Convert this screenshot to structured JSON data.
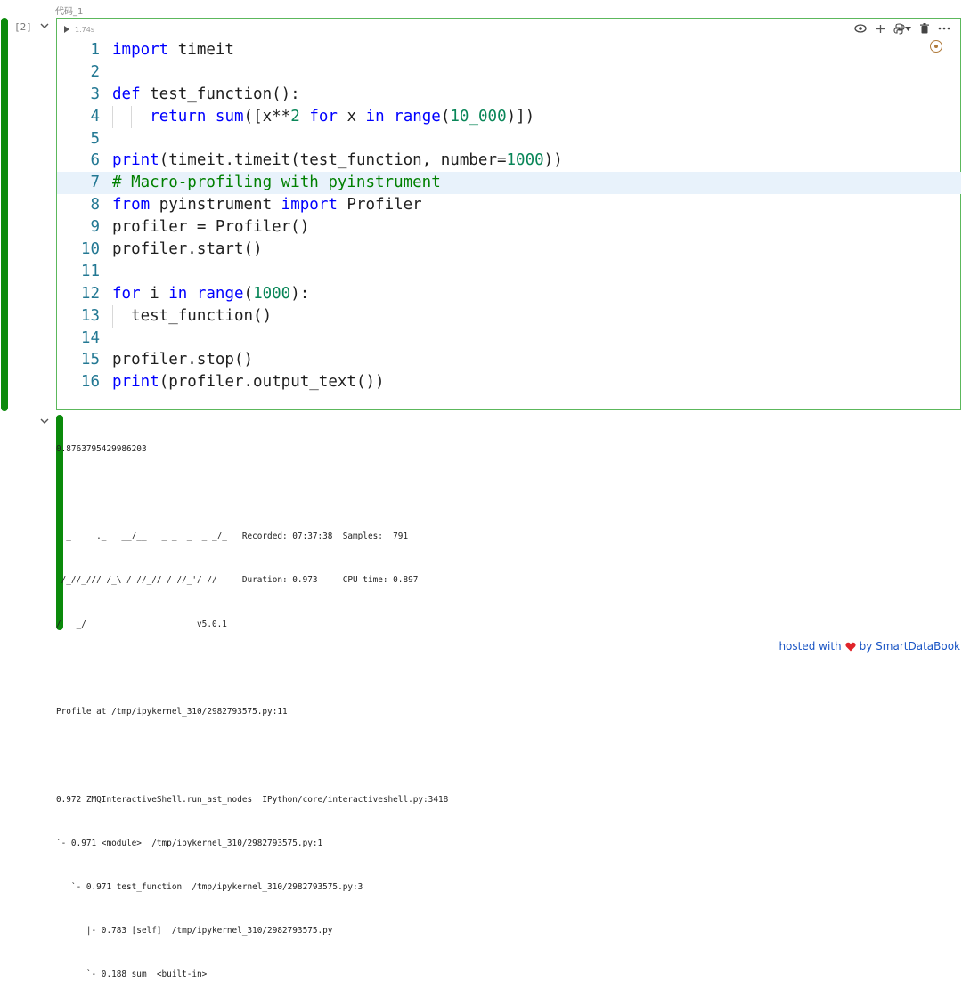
{
  "cell": {
    "label": "代码_1",
    "exec_count": "[2]",
    "exec_time": "1.74s"
  },
  "code_lines": [
    {
      "num": "1",
      "text": "import timeit"
    },
    {
      "num": "2",
      "text": ""
    },
    {
      "num": "3",
      "text": "def test_function():"
    },
    {
      "num": "4",
      "text": "    return sum([x**2 for x in range(10_000)])"
    },
    {
      "num": "5",
      "text": ""
    },
    {
      "num": "6",
      "text": "print(timeit.timeit(test_function, number=1000))"
    },
    {
      "num": "7",
      "text": "# Macro-profiling with pyinstrument"
    },
    {
      "num": "8",
      "text": "from pyinstrument import Profiler"
    },
    {
      "num": "9",
      "text": "profiler = Profiler()"
    },
    {
      "num": "10",
      "text": "profiler.start()"
    },
    {
      "num": "11",
      "text": ""
    },
    {
      "num": "12",
      "text": "for i in range(1000):"
    },
    {
      "num": "13",
      "text": "  test_function()"
    },
    {
      "num": "14",
      "text": ""
    },
    {
      "num": "15",
      "text": "profiler.stop()"
    },
    {
      "num": "16",
      "text": "print(profiler.output_text())"
    }
  ],
  "output_lines": [
    "0.8763795429986203",
    "",
    "  _     ._   __/__   _ _  _  _ _/_   Recorded: 07:37:38  Samples:  791",
    " /_//_/// /_\\ / //_// / //_'/ //     Duration: 0.973     CPU time: 0.897",
    "/   _/                      v5.0.1",
    "",
    "Profile at /tmp/ipykernel_310/2982793575.py:11",
    "",
    "0.972 ZMQInteractiveShell.run_ast_nodes  IPython/core/interactiveshell.py:3418",
    "`- 0.971 <module>  /tmp/ipykernel_310/2982793575.py:1",
    "   `- 0.971 test_function  /tmp/ipykernel_310/2982793575.py:3",
    "      |- 0.783 [self]  /tmp/ipykernel_310/2982793575.py",
    "      `- 0.188 sum  <built-in>"
  ],
  "footer": {
    "prefix": "hosted with",
    "suffix": "by SmartDataBook"
  },
  "colors": {
    "accent_green": "#0b8a0b",
    "keyword": "#0000ff",
    "number": "#098658",
    "comment": "#008000",
    "line_number": "#237893",
    "highlight": "#e8f2fb",
    "heart": "#e0242a",
    "link": "#1a55c4"
  },
  "icons": [
    "run-icon",
    "collapse-icon",
    "eye-icon",
    "plus-icon",
    "python-icon",
    "chevron-down-icon",
    "trash-icon",
    "more-icon",
    "ai-assistant-icon",
    "heart-icon"
  ]
}
